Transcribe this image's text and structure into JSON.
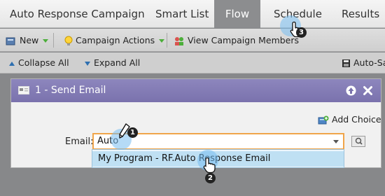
{
  "tabs": [
    {
      "label": "Auto Response Campaign"
    },
    {
      "label": "Smart List"
    },
    {
      "label": "Flow"
    },
    {
      "label": "Schedule"
    },
    {
      "label": "Results"
    }
  ],
  "toolbar": {
    "new_label": "New",
    "actions_label": "Campaign Actions",
    "members_label": "View Campaign Members"
  },
  "collapse_row": {
    "collapse_label": "Collapse All",
    "expand_label": "Expand All",
    "autosave_label": "Auto-Sav"
  },
  "step": {
    "title": "1 - Send Email",
    "add_choice_label": "Add Choice",
    "email_label": "Email:",
    "email_value": "Auto"
  },
  "dropdown": {
    "items": [
      "My Program - RF.Auto Response Email"
    ]
  },
  "annotations": {
    "badge_1": "1",
    "badge_2": "2",
    "badge_3": "3"
  },
  "colors": {
    "step_header": "#7f77b2",
    "active_tab": "#8c8d8f",
    "input_focus_border": "#f0a54a",
    "dropdown_highlight": "#bfe0f3",
    "highlight_circle": "#78bef0"
  }
}
